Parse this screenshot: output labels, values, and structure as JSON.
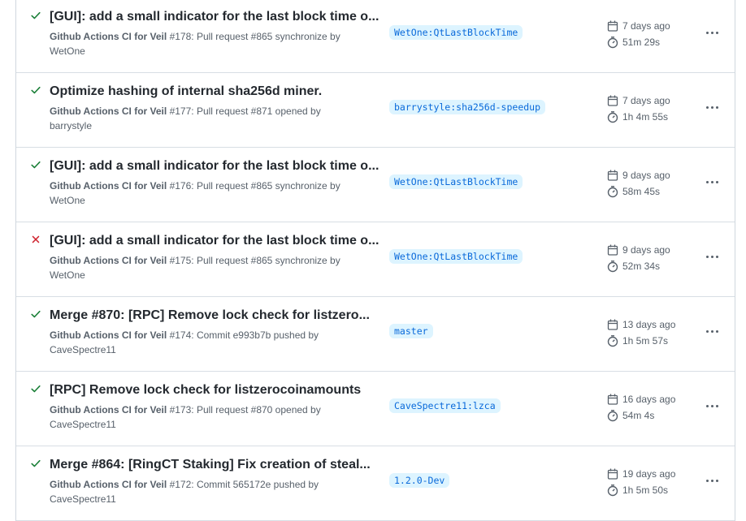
{
  "colors": {
    "success": "#1a7f37",
    "failure": "#cf222e",
    "branch_text": "#0969da",
    "branch_bg": "#ddf4ff"
  },
  "runs": [
    {
      "status": "success",
      "title": "[GUI]: add a small indicator for the last block time o...",
      "workflow": "Github Actions CI for Veil",
      "run_number": "#178",
      "event_text": ": Pull request #865 synchronize by",
      "actor": "WetOne",
      "branch": "WetOne:QtLastBlockTime",
      "date": "7 days ago",
      "duration": "51m 29s"
    },
    {
      "status": "success",
      "title": "Optimize hashing of internal sha256d miner.",
      "workflow": "Github Actions CI for Veil",
      "run_number": "#177",
      "event_text": ": Pull request #871 opened by",
      "actor": "barrystyle",
      "branch": "barrystyle:sha256d-speedup",
      "date": "7 days ago",
      "duration": "1h 4m 55s"
    },
    {
      "status": "success",
      "title": "[GUI]: add a small indicator for the last block time o...",
      "workflow": "Github Actions CI for Veil",
      "run_number": "#176",
      "event_text": ": Pull request #865 synchronize by",
      "actor": "WetOne",
      "branch": "WetOne:QtLastBlockTime",
      "date": "9 days ago",
      "duration": "58m 45s"
    },
    {
      "status": "failure",
      "title": "[GUI]: add a small indicator for the last block time o...",
      "workflow": "Github Actions CI for Veil",
      "run_number": "#175",
      "event_text": ": Pull request #865 synchronize by",
      "actor": "WetOne",
      "branch": "WetOne:QtLastBlockTime",
      "date": "9 days ago",
      "duration": "52m 34s"
    },
    {
      "status": "success",
      "title": "Merge #870: [RPC] Remove lock check for listzero...",
      "workflow": "Github Actions CI for Veil",
      "run_number": "#174",
      "event_text": ": Commit e993b7b pushed by",
      "actor": "CaveSpectre11",
      "branch": "master",
      "date": "13 days ago",
      "duration": "1h 5m 57s"
    },
    {
      "status": "success",
      "title": "[RPC] Remove lock check for listzerocoinamounts",
      "workflow": "Github Actions CI for Veil",
      "run_number": "#173",
      "event_text": ": Pull request #870 opened by",
      "actor": "CaveSpectre11",
      "branch": "CaveSpectre11:lzca",
      "date": "16 days ago",
      "duration": "54m 4s"
    },
    {
      "status": "success",
      "title": "Merge #864: [RingCT Staking] Fix creation of steal...",
      "workflow": "Github Actions CI for Veil",
      "run_number": "#172",
      "event_text": ": Commit 565172e pushed by",
      "actor": "CaveSpectre11",
      "branch": "1.2.0-Dev",
      "date": "19 days ago",
      "duration": "1h 5m 50s"
    }
  ]
}
